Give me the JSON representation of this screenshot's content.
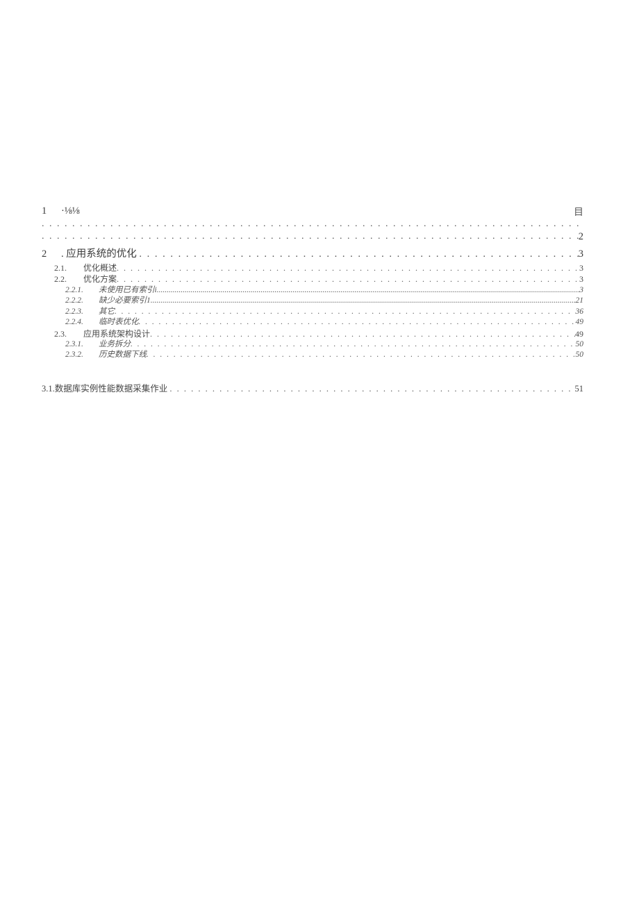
{
  "mu_glyph": "目",
  "entry1": {
    "num": "1",
    "title": "·⅛⅛",
    "page": "2"
  },
  "entry2": {
    "num": "2",
    "title": ". 应用系统的优化",
    "page": "3"
  },
  "sub": [
    {
      "num": "2.1.",
      "title": "优化概述",
      "page": "3",
      "italic": false
    },
    {
      "num": "2.2.",
      "title": "优化方案",
      "page": "3",
      "italic": false
    },
    {
      "num": "2.2.1.",
      "title": "未使用已有索引i",
      "page": "3",
      "italic": true,
      "tight": true
    },
    {
      "num": "2.2.2.",
      "title": "缺少必要索引1",
      "page": "21",
      "italic": true,
      "tight": true
    },
    {
      "num": "2.2.3.",
      "title": "其它",
      "page": "36",
      "italic": true
    },
    {
      "num": "2.2.4.",
      "title": "临时表优化",
      "page": "49",
      "italic": true
    },
    {
      "num": "2.3.",
      "title": "应用系统架构设计",
      "page": "49",
      "italic": false
    },
    {
      "num": "2.3.1.",
      "title": "业务拆分",
      "page": "50",
      "italic": true
    },
    {
      "num": "2.3.2.",
      "title": "历史数据下线",
      "page": "50",
      "italic": true
    }
  ],
  "entry31": {
    "label": "3.1.数据库实例性能数据采集作业",
    "page": "51"
  }
}
